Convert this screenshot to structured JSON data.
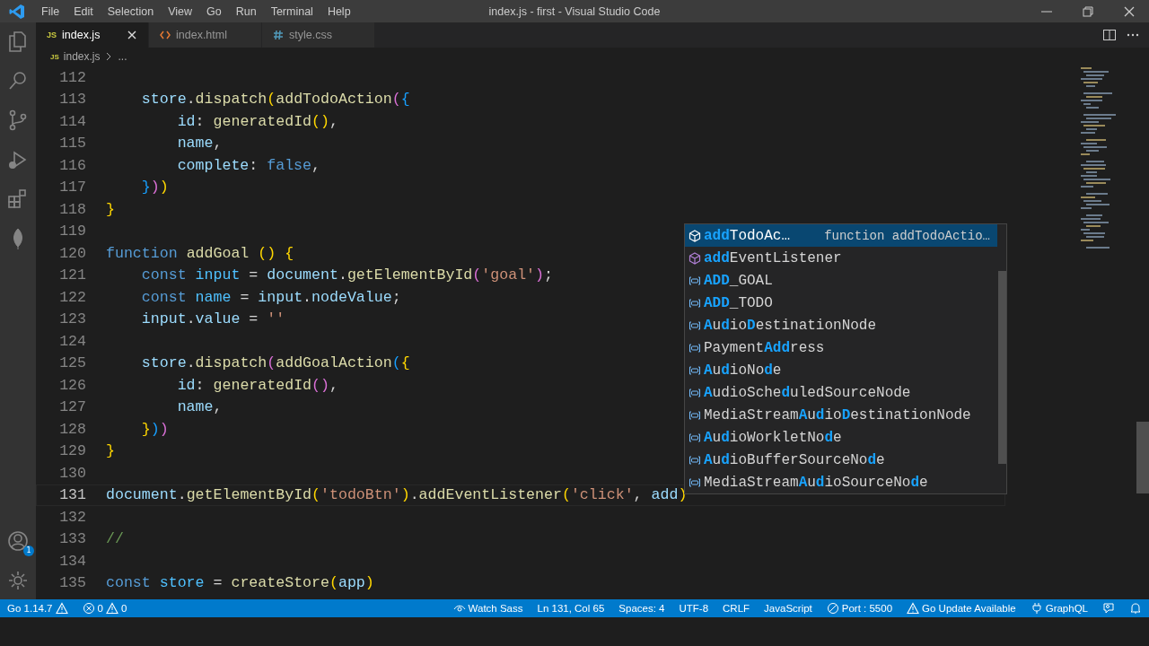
{
  "title_bar": {
    "menu": [
      "File",
      "Edit",
      "Selection",
      "View",
      "Go",
      "Run",
      "Terminal",
      "Help"
    ],
    "title": "index.js - first - Visual Studio Code"
  },
  "tabs": [
    {
      "label": "index.js",
      "kind": "js",
      "icon_text": "JS",
      "selected": true
    },
    {
      "label": "index.html",
      "kind": "html",
      "selected": false
    },
    {
      "label": "style.css",
      "kind": "css",
      "selected": false
    }
  ],
  "breadcrumb": {
    "icon_text": "JS",
    "file": "index.js",
    "more": "..."
  },
  "activity_bar": {
    "accounts_badge": "1"
  },
  "editor": {
    "lines": [
      {
        "number": "112",
        "current": false
      },
      {
        "number": "113",
        "current": false,
        "tokens": [
          {
            "kind": "var",
            "text": "    store"
          },
          {
            "kind": "p",
            "text": "."
          },
          {
            "kind": "fn",
            "text": "dispatch"
          },
          {
            "kind": "b1",
            "text": "("
          },
          {
            "kind": "fn",
            "text": "addTodoAction"
          },
          {
            "kind": "b2",
            "text": "("
          },
          {
            "kind": "b3",
            "text": "{"
          }
        ]
      },
      {
        "number": "114",
        "current": false,
        "tokens": [
          {
            "kind": "var",
            "text": "        id"
          },
          {
            "kind": "p",
            "text": ": "
          },
          {
            "kind": "fn",
            "text": "generatedId"
          },
          {
            "kind": "b1",
            "text": "()"
          },
          {
            "kind": "p",
            "text": ","
          }
        ]
      },
      {
        "number": "115",
        "current": false,
        "tokens": [
          {
            "kind": "var",
            "text": "        name"
          },
          {
            "kind": "p",
            "text": ","
          }
        ]
      },
      {
        "number": "116",
        "current": false,
        "tokens": [
          {
            "kind": "var",
            "text": "        complete"
          },
          {
            "kind": "p",
            "text": ": "
          },
          {
            "kind": "kw",
            "text": "false"
          },
          {
            "kind": "p",
            "text": ","
          }
        ]
      },
      {
        "number": "117",
        "current": false,
        "tokens": [
          {
            "kind": "b3",
            "text": "    }"
          },
          {
            "kind": "b2",
            "text": ")"
          },
          {
            "kind": "b1",
            "text": ")"
          }
        ]
      },
      {
        "number": "118",
        "current": false,
        "tokens": [
          {
            "kind": "b1",
            "text": "}"
          }
        ]
      },
      {
        "number": "119",
        "current": false
      },
      {
        "number": "120",
        "current": false,
        "tokens": [
          {
            "kind": "kw",
            "text": "function "
          },
          {
            "kind": "fn",
            "text": "addGoal"
          },
          {
            "kind": "b1",
            "text": " () "
          },
          {
            "kind": "b1",
            "text": "{"
          }
        ]
      },
      {
        "number": "121",
        "current": false,
        "tokens": [
          {
            "kind": "kw",
            "text": "    const "
          },
          {
            "kind": "cvar",
            "text": "input"
          },
          {
            "kind": "p",
            "text": " = "
          },
          {
            "kind": "var",
            "text": "document"
          },
          {
            "kind": "p",
            "text": "."
          },
          {
            "kind": "fn",
            "text": "getElementById"
          },
          {
            "kind": "b2",
            "text": "("
          },
          {
            "kind": "str",
            "text": "'goal'"
          },
          {
            "kind": "b2",
            "text": ")"
          },
          {
            "kind": "p",
            "text": ";"
          }
        ]
      },
      {
        "number": "122",
        "current": false,
        "tokens": [
          {
            "kind": "kw",
            "text": "    const "
          },
          {
            "kind": "cvar",
            "text": "name"
          },
          {
            "kind": "p",
            "text": " = "
          },
          {
            "kind": "var",
            "text": "input"
          },
          {
            "kind": "p",
            "text": "."
          },
          {
            "kind": "var",
            "text": "nodeValue"
          },
          {
            "kind": "p",
            "text": ";"
          }
        ]
      },
      {
        "number": "123",
        "current": false,
        "tokens": [
          {
            "kind": "var",
            "text": "    input"
          },
          {
            "kind": "p",
            "text": "."
          },
          {
            "kind": "var",
            "text": "value"
          },
          {
            "kind": "p",
            "text": " = "
          },
          {
            "kind": "str",
            "text": "''"
          }
        ]
      },
      {
        "number": "124",
        "current": false
      },
      {
        "number": "125",
        "current": false,
        "tokens": [
          {
            "kind": "var",
            "text": "    store"
          },
          {
            "kind": "p",
            "text": "."
          },
          {
            "kind": "fn",
            "text": "dispatch"
          },
          {
            "kind": "b2",
            "text": "("
          },
          {
            "kind": "fn",
            "text": "addGoalAction"
          },
          {
            "kind": "b3",
            "text": "("
          },
          {
            "kind": "b1",
            "text": "{"
          }
        ]
      },
      {
        "number": "126",
        "current": false,
        "tokens": [
          {
            "kind": "var",
            "text": "        id"
          },
          {
            "kind": "p",
            "text": ": "
          },
          {
            "kind": "fn",
            "text": "generatedId"
          },
          {
            "kind": "b2",
            "text": "()"
          },
          {
            "kind": "p",
            "text": ","
          }
        ]
      },
      {
        "number": "127",
        "current": false,
        "tokens": [
          {
            "kind": "var",
            "text": "        name"
          },
          {
            "kind": "p",
            "text": ","
          }
        ]
      },
      {
        "number": "128",
        "current": false,
        "tokens": [
          {
            "kind": "b1",
            "text": "    }"
          },
          {
            "kind": "b3",
            "text": ")"
          },
          {
            "kind": "b2",
            "text": ")"
          }
        ]
      },
      {
        "number": "129",
        "current": false,
        "tokens": [
          {
            "kind": "b1",
            "text": "}"
          }
        ]
      },
      {
        "number": "130",
        "current": false
      },
      {
        "number": "131",
        "current": true,
        "tokens": [
          {
            "kind": "var",
            "text": "document"
          },
          {
            "kind": "p",
            "text": "."
          },
          {
            "kind": "fn",
            "text": "getElementById"
          },
          {
            "kind": "b1",
            "text": "("
          },
          {
            "kind": "str",
            "text": "'todoBtn'"
          },
          {
            "kind": "b1",
            "text": ")"
          },
          {
            "kind": "p",
            "text": "."
          },
          {
            "kind": "fn",
            "text": "addEventListener"
          },
          {
            "kind": "b1",
            "text": "("
          },
          {
            "kind": "str",
            "text": "'click'"
          },
          {
            "kind": "p",
            "text": ", "
          },
          {
            "kind": "var",
            "text": "add"
          },
          {
            "kind": "b1",
            "text": ")"
          }
        ]
      },
      {
        "number": "132",
        "current": false
      },
      {
        "number": "133",
        "current": false,
        "tokens": [
          {
            "kind": "cm",
            "text": "//"
          }
        ]
      },
      {
        "number": "134",
        "current": false
      },
      {
        "number": "135",
        "current": false,
        "tokens": [
          {
            "kind": "kw",
            "text": "const "
          },
          {
            "kind": "cvar",
            "text": "store"
          },
          {
            "kind": "p",
            "text": " = "
          },
          {
            "kind": "fn",
            "text": "createStore"
          },
          {
            "kind": "b1",
            "text": "("
          },
          {
            "kind": "var",
            "text": "app"
          },
          {
            "kind": "b1",
            "text": ")"
          }
        ]
      }
    ]
  },
  "suggest": {
    "items": [
      {
        "kind": "method",
        "selected": true,
        "detail": "function addTodoActio…",
        "parts": [
          {
            "text": "add",
            "match": true
          },
          {
            "text": "TodoAc…",
            "match": false
          }
        ]
      },
      {
        "kind": "method",
        "selected": false,
        "parts": [
          {
            "text": "add",
            "match": true
          },
          {
            "text": "EventListener",
            "match": false
          }
        ]
      },
      {
        "kind": "variable",
        "selected": false,
        "parts": [
          {
            "text": "ADD",
            "match": true
          },
          {
            "text": "_GOAL",
            "match": false
          }
        ]
      },
      {
        "kind": "variable",
        "selected": false,
        "parts": [
          {
            "text": "ADD",
            "match": true
          },
          {
            "text": "_TODO",
            "match": false
          }
        ]
      },
      {
        "kind": "variable",
        "selected": false,
        "parts": [
          {
            "text": "A",
            "match": true
          },
          {
            "text": "u",
            "match": false
          },
          {
            "text": "d",
            "match": true
          },
          {
            "text": "io",
            "match": false
          },
          {
            "text": "D",
            "match": true
          },
          {
            "text": "estinationNode",
            "match": false
          }
        ]
      },
      {
        "kind": "variable",
        "selected": false,
        "parts": [
          {
            "text": "Payment",
            "match": false
          },
          {
            "text": "Add",
            "match": true
          },
          {
            "text": "ress",
            "match": false
          }
        ]
      },
      {
        "kind": "variable",
        "selected": false,
        "parts": [
          {
            "text": "A",
            "match": true
          },
          {
            "text": "u",
            "match": false
          },
          {
            "text": "d",
            "match": true
          },
          {
            "text": "ioNo",
            "match": false
          },
          {
            "text": "d",
            "match": true
          },
          {
            "text": "e",
            "match": false
          }
        ]
      },
      {
        "kind": "variable",
        "selected": false,
        "parts": [
          {
            "text": "A",
            "match": true
          },
          {
            "text": "u",
            "match": false
          },
          {
            "text": "dioSche",
            "match": false
          },
          {
            "text": "d",
            "match": true
          },
          {
            "text": "uledSourceNode",
            "match": false
          }
        ]
      },
      {
        "kind": "variable",
        "selected": false,
        "parts": [
          {
            "text": "MediaStream",
            "match": false
          },
          {
            "text": "A",
            "match": true
          },
          {
            "text": "u",
            "match": false
          },
          {
            "text": "d",
            "match": true
          },
          {
            "text": "io",
            "match": false
          },
          {
            "text": "D",
            "match": true
          },
          {
            "text": "estinationNode",
            "match": false
          }
        ]
      },
      {
        "kind": "variable",
        "selected": false,
        "parts": [
          {
            "text": "A",
            "match": true
          },
          {
            "text": "u",
            "match": false
          },
          {
            "text": "d",
            "match": true
          },
          {
            "text": "ioWorkletNo",
            "match": false
          },
          {
            "text": "d",
            "match": true
          },
          {
            "text": "e",
            "match": false
          }
        ]
      },
      {
        "kind": "variable",
        "selected": false,
        "parts": [
          {
            "text": "A",
            "match": true
          },
          {
            "text": "u",
            "match": false
          },
          {
            "text": "d",
            "match": true
          },
          {
            "text": "ioBufferSourceNo",
            "match": false
          },
          {
            "text": "d",
            "match": true
          },
          {
            "text": "e",
            "match": false
          }
        ]
      },
      {
        "kind": "variable",
        "selected": false,
        "parts": [
          {
            "text": "MediaStream",
            "match": false
          },
          {
            "text": "A",
            "match": true
          },
          {
            "text": "u",
            "match": false
          },
          {
            "text": "d",
            "match": true
          },
          {
            "text": "ioSourceNo",
            "match": false
          },
          {
            "text": "d",
            "match": true
          },
          {
            "text": "e",
            "match": false
          }
        ]
      }
    ]
  },
  "status_bar": {
    "left": [
      {
        "kind": "go",
        "text": "Go 1.14.7"
      },
      {
        "kind": "problems",
        "errors": "0",
        "warnings": "0"
      }
    ],
    "right": [
      {
        "kind": "eye",
        "text": "Watch Sass"
      },
      {
        "kind": "plain",
        "text": "Ln 131, Col 65"
      },
      {
        "kind": "plain",
        "text": "Spaces: 4"
      },
      {
        "kind": "plain",
        "text": "UTF-8"
      },
      {
        "kind": "plain",
        "text": "CRLF"
      },
      {
        "kind": "plain",
        "text": "JavaScript"
      },
      {
        "kind": "port",
        "text": "Port : 5500"
      },
      {
        "kind": "warning",
        "text": "Go Update Available"
      },
      {
        "kind": "plug",
        "text": "GraphQL"
      },
      {
        "kind": "feedback"
      },
      {
        "kind": "bell"
      }
    ]
  }
}
